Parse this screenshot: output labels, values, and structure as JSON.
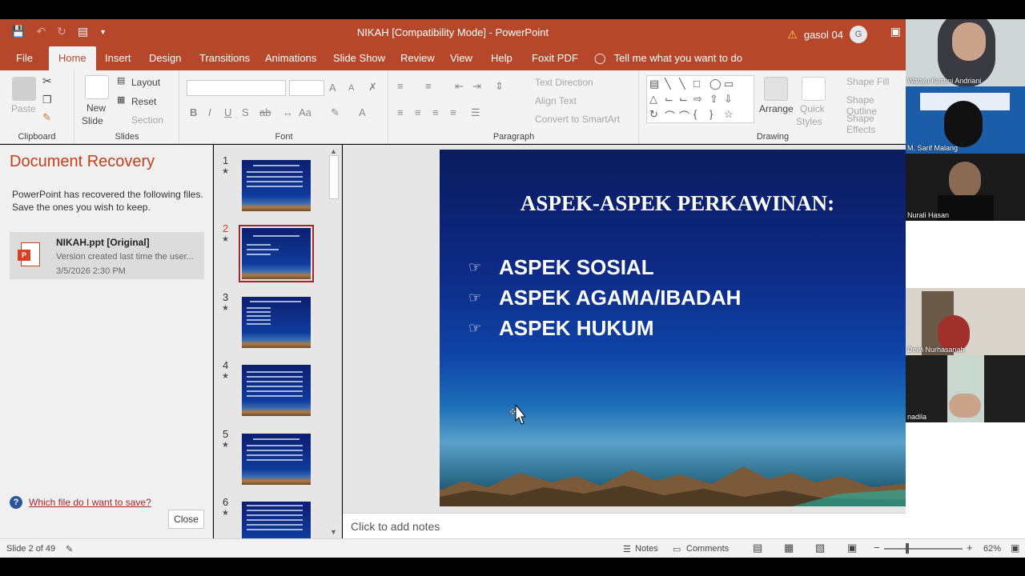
{
  "window": {
    "title": "NIKAH [Compatibility Mode]  -  PowerPoint",
    "user_name": "gasol 04",
    "user_initial": "G"
  },
  "tabs": [
    "File",
    "Home",
    "Insert",
    "Design",
    "Transitions",
    "Animations",
    "Slide Show",
    "Review",
    "View",
    "Help",
    "Foxit PDF"
  ],
  "active_tab": "Home",
  "tell_me": "Tell me what you want to do",
  "ribbon": {
    "clipboard": {
      "paste": "Paste",
      "label": "Clipboard"
    },
    "slides": {
      "new_slide": "New",
      "new_slide_2": "Slide",
      "layout": "Layout",
      "reset": "Reset",
      "section": "Section",
      "label": "Slides"
    },
    "font": {
      "label": "Font",
      "bold": "B",
      "italic": "I",
      "underline": "U",
      "strike": "S",
      "spacing": "ab",
      "case": "Aa",
      "grow": "A",
      "shrink": "A"
    },
    "paragraph": {
      "label": "Paragraph",
      "text_direction": "Text Direction",
      "align_text": "Align Text",
      "smartart": "Convert to SmartArt"
    },
    "drawing": {
      "label": "Drawing",
      "arrange": "Arrange",
      "quick_styles": "Quick",
      "quick_styles_2": "Styles",
      "shape_fill": "Shape Fill",
      "shape_outline": "Shape Outline",
      "shape_effects": "Shape Effects"
    }
  },
  "recovery": {
    "title": "Document Recovery",
    "description": "PowerPoint has recovered the following files. Save the ones you wish to keep.",
    "file_name": "NIKAH.ppt  [Original]",
    "file_version": "Version created last time the user...",
    "file_date": "3/5/2026 2:30 PM",
    "help_link": "Which file do I want to save?",
    "close": "Close"
  },
  "thumbnails": [
    {
      "num": "1"
    },
    {
      "num": "2"
    },
    {
      "num": "3"
    },
    {
      "num": "4"
    },
    {
      "num": "5"
    },
    {
      "num": "6"
    }
  ],
  "current_slide_index": 2,
  "slide": {
    "title": "ASPEK-ASPEK PERKAWINAN:",
    "bullets": [
      "ASPEK SOSIAL",
      "ASPEK AGAMA/IBADAH",
      "ASPEK HUKUM"
    ]
  },
  "notes_placeholder": "Click to add notes",
  "status": {
    "slide_of": "Slide 2 of 49",
    "notes": "Notes",
    "comments": "Comments",
    "zoom": "62%"
  },
  "participants": [
    {
      "name": "Wahyu Kustini Andriani"
    },
    {
      "name": "M. Sarif Malang"
    },
    {
      "name": "Nurali Hasan"
    },
    {
      "name": "Dewi Nurhasanah"
    },
    {
      "name": "nadila"
    }
  ],
  "colors": {
    "accent": "#b7472a",
    "link": "#a4262c",
    "recovery_title": "#c43e1c"
  }
}
